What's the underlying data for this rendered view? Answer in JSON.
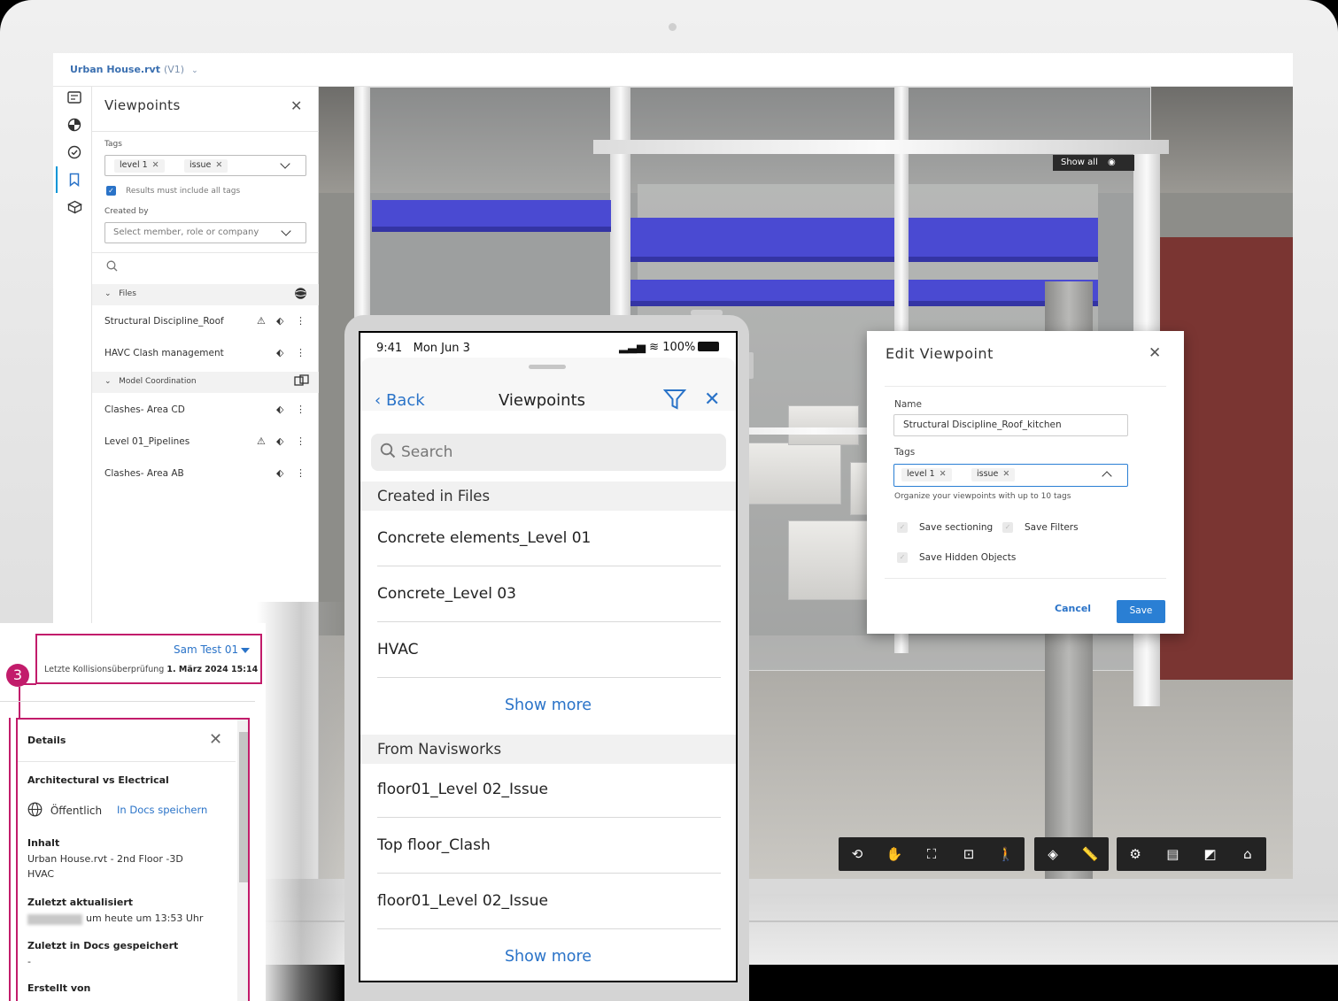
{
  "desktop": {
    "file_title": "Urban House.rvt",
    "file_version": "(V1)",
    "viewpoints_panel": {
      "title": "Viewpoints",
      "tags_label": "Tags",
      "tags": [
        "level 1",
        "issue"
      ],
      "checkbox_label": "Results must include all tags",
      "created_by_label": "Created by",
      "created_by_placeholder": "Select member, role or company",
      "groups": [
        {
          "label": "Files"
        },
        {
          "label": "Model Coordination"
        }
      ],
      "items": [
        {
          "name": "Structural Discipline_Roof"
        },
        {
          "name": "HAVC Clash management"
        },
        {
          "name": "Clashes- Area CD"
        },
        {
          "name": "Level 01_Pipelines"
        },
        {
          "name": "Clashes- Area AB"
        }
      ]
    },
    "viewer": {
      "show_all_label": "Show all"
    },
    "edit_dialog": {
      "title": "Edit Viewpoint",
      "name_label": "Name",
      "name_value": "Structural Discipline_Roof_kitchen",
      "tags_label": "Tags",
      "tags": [
        "level 1",
        "issue"
      ],
      "tags_hint": "Organize your viewpoints with up to 10 tags",
      "save_sectioning": "Save sectioning",
      "save_filters": "Save Filters",
      "save_hidden": "Save Hidden Objects",
      "cancel": "Cancel",
      "save": "Save"
    }
  },
  "collision_panel": {
    "badge": "3",
    "user": "Sam Test 01",
    "last_check_label": "Letzte Kollisionsüberprüfung",
    "last_check_value": "1. März 2024 15:14",
    "details_title": "Details",
    "subtitle": "Architectural vs Electrical",
    "visibility": "Öffentlich",
    "save_link": "In Docs speichern",
    "content_label": "Inhalt",
    "content_line1": "Urban House.rvt - 2nd Floor -3D",
    "content_line2": "HVAC",
    "updated_label": "Zuletzt aktualisiert",
    "updated_value": "um heute um 13:53 Uhr",
    "saved_label": "Zuletzt in Docs gespeichert",
    "saved_value": "-",
    "created_label": "Erstellt von"
  },
  "tablet": {
    "time": "9:41",
    "date": "Mon Jun 3",
    "battery": "100%",
    "back": "Back",
    "title": "Viewpoints",
    "search_placeholder": "Search",
    "sections": [
      {
        "title": "Created in Files",
        "items": [
          "Concrete elements_Level 01",
          "Concrete_Level 03",
          "HVAC"
        ],
        "more": "Show more"
      },
      {
        "title": "From Navisworks",
        "items": [
          "floor01_Level 02_Issue",
          "Top floor_Clash",
          "floor01_Level 02_Issue"
        ],
        "more": "Show more"
      }
    ]
  }
}
